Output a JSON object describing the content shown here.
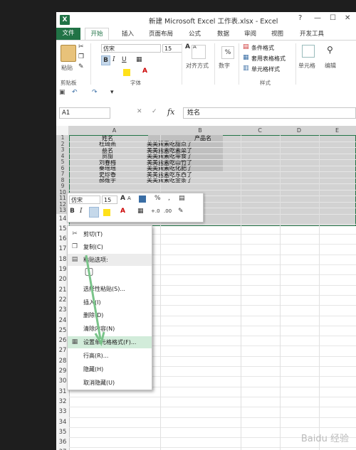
{
  "window": {
    "title": "新建 Microsoft Excel 工作表.xlsx - Excel",
    "app_icon": "X",
    "help": "?",
    "minimize": "—",
    "restore": "☐",
    "close": "✕"
  },
  "ribbon_tabs": {
    "file": "文件",
    "home": "开始",
    "others": [
      "插入",
      "页面布局",
      "公式",
      "数据",
      "审阅",
      "视图",
      "开发工具"
    ]
  },
  "ribbon": {
    "paste_label": "粘贴",
    "clipboard_group": "剪贴板",
    "font_name": "仿宋",
    "font_size": "15",
    "font_group": "字体",
    "align_label": "对齐方式",
    "number_label": "数字",
    "cond_format": "条件格式",
    "table_format": "套用表格格式",
    "cell_style": "单元格样式",
    "styles_group": "样式",
    "cells_label": "单元格",
    "edit_label": "编辑",
    "bold": "B",
    "italic": "I",
    "underline": "U",
    "grow": "A",
    "shrink": "A",
    "percent": "%"
  },
  "formula_bar": {
    "name_box": "A1",
    "fx": "fx",
    "cancel": "✕",
    "enter": "✓",
    "content": "姓名"
  },
  "grid": {
    "columns": [
      "A",
      "B",
      "C",
      "D",
      "E"
    ],
    "rows": [
      "1",
      "2",
      "3",
      "4",
      "5",
      "6",
      "7",
      "8",
      "9",
      "10",
      "11",
      "12",
      "13",
      "14",
      "15",
      "16",
      "17",
      "18",
      "19",
      "20",
      "21",
      "22",
      "23",
      "24",
      "25",
      "26",
      "27",
      "28",
      "29",
      "30",
      "31",
      "32",
      "33",
      "34",
      "35",
      "36",
      "37",
      "38"
    ],
    "colA": [
      "姓名",
      "杜琦燕",
      "蔡名",
      "贾甜",
      "刘春梅",
      "秦瑶瑶",
      "史珍香",
      "郝维宇",
      "",
      "",
      "",
      "",
      ""
    ],
    "colB": [
      "产品名",
      "美美素素吃甜点了",
      "美美素素吃素菜了",
      "美美素素吃零食了",
      "美美素素吃山竹了",
      "美美素素吃化肥了",
      "美美素素吃东西了",
      "美美素素吃金条了",
      "",
      "",
      "",
      "",
      ""
    ]
  },
  "mini_toolbar": {
    "font": "仿宋",
    "size": "15",
    "bold": "B",
    "italic": "I",
    "percent": "%",
    "comma": ",",
    "inc_dec": "+.0",
    "dec_dec": ".00"
  },
  "context_menu": {
    "items": [
      {
        "label": "剪切(T)",
        "icon": "scissors-icon"
      },
      {
        "label": "复制(C)",
        "icon": "copy-icon"
      },
      {
        "label": "粘贴选项:",
        "icon": "paste-icon"
      },
      {
        "label": "",
        "icon": "clipboard-icon"
      },
      {
        "label": "选择性粘贴(S)...",
        "icon": ""
      },
      {
        "label": "插入(I)",
        "icon": ""
      },
      {
        "label": "删除(D)",
        "icon": ""
      },
      {
        "label": "清除内容(N)",
        "icon": ""
      },
      {
        "label": "设置单元格格式(F)...",
        "icon": "format-cells-icon"
      },
      {
        "label": "行高(R)...",
        "icon": ""
      },
      {
        "label": "隐藏(H)",
        "icon": ""
      },
      {
        "label": "取消隐藏(U)",
        "icon": ""
      }
    ]
  },
  "watermark": "Baidu 经验"
}
